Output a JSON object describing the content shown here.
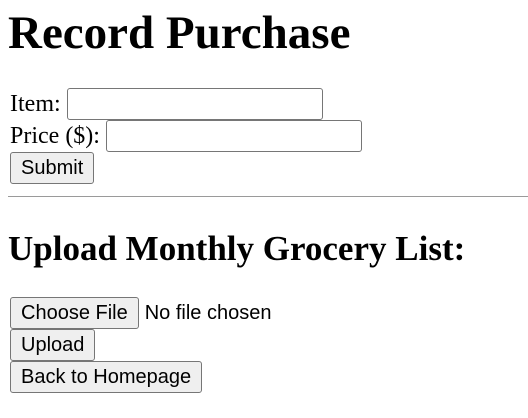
{
  "purchase_form": {
    "heading": "Record Purchase",
    "item_label": "Item:",
    "item_value": "",
    "price_label": "Price ($):",
    "price_value": "",
    "submit_label": "Submit"
  },
  "upload_section": {
    "heading": "Upload Monthly Grocery List:",
    "choose_file_label": "Choose File",
    "file_status": "No file chosen",
    "upload_label": "Upload"
  },
  "navigation": {
    "back_label": "Back to Homepage"
  }
}
